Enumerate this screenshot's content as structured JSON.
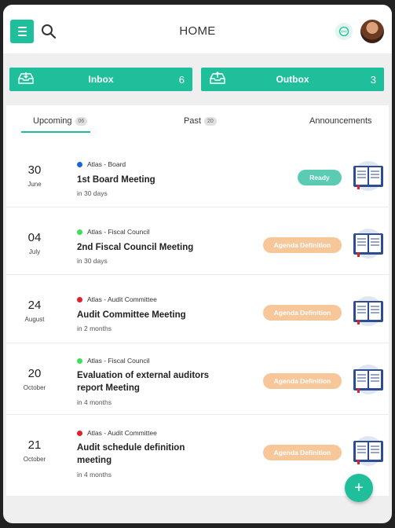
{
  "header": {
    "title": "HOME"
  },
  "mail": {
    "inbox": {
      "label": "Inbox",
      "count": "6"
    },
    "outbox": {
      "label": "Outbox",
      "count": "3"
    }
  },
  "tabs": [
    {
      "label": "Upcoming",
      "badge": "06"
    },
    {
      "label": "Past",
      "badge": "20"
    },
    {
      "label": "Announcements"
    }
  ],
  "meetings": [
    {
      "day": "30",
      "month": "June",
      "org": "Atlas - Board",
      "org_color": "#1a66d6",
      "title": "1st Board Meeting",
      "when": "in 30 days",
      "status": "Ready"
    },
    {
      "day": "04",
      "month": "July",
      "org": "Atlas - Fiscal Council",
      "org_color": "#3de05c",
      "title": "2nd Fiscal Council Meeting",
      "when": "in 30 days",
      "status": "Agenda Definition"
    },
    {
      "day": "24",
      "month": "August",
      "org": "Atlas - Audit Committee",
      "org_color": "#e0202a",
      "title": "Audit Committee Meeting",
      "when": "in 2 months",
      "status": "Agenda Definition"
    },
    {
      "day": "20",
      "month": "October",
      "org": "Atlas - Fiscal Council",
      "org_color": "#3de05c",
      "title": "Evaluation of external auditors report Meeting",
      "when": "in 4 months",
      "status": "Agenda Definition"
    },
    {
      "day": "21",
      "month": "October",
      "org": "Atlas - Audit Committee",
      "org_color": "#e0202a",
      "title": "Audit schedule definition meeting",
      "when": "in 4 months",
      "status": "Agenda Definition"
    }
  ],
  "fab": {
    "label": "+"
  },
  "colors": {
    "accent": "#1fbf9c",
    "ready": "#5ccbb4",
    "agenda": "#f7c79a"
  }
}
